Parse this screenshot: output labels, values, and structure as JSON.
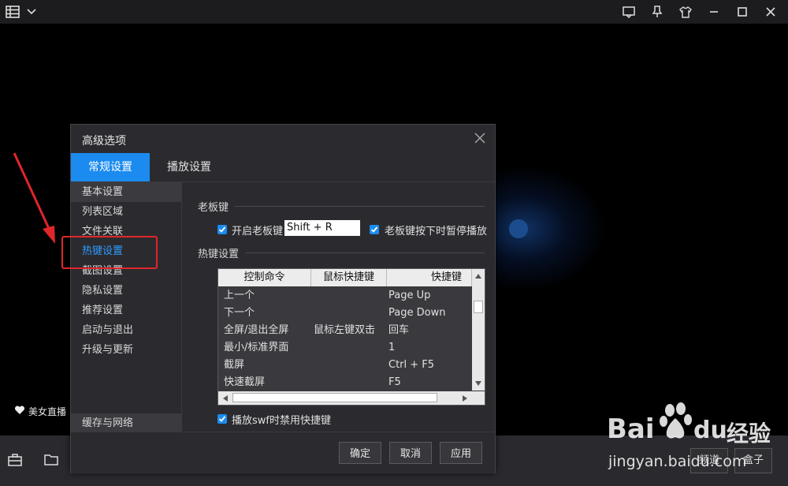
{
  "dialog": {
    "title": "高级选项",
    "tabs": [
      {
        "label": "常规设置",
        "active": true
      },
      {
        "label": "播放设置",
        "active": false
      }
    ],
    "sidebar": [
      {
        "label": "基本设置"
      },
      {
        "label": "列表区域"
      },
      {
        "label": "文件关联"
      },
      {
        "label": "热键设置",
        "selected": true
      },
      {
        "label": "截图设置"
      },
      {
        "label": "隐私设置"
      },
      {
        "label": "推荐设置"
      },
      {
        "label": "启动与退出"
      },
      {
        "label": "升级与更新"
      }
    ],
    "sidebar_bottom": "缓存与网络",
    "boss_key": {
      "section": "老板键",
      "enable_label": "开启老板键",
      "enable_checked": true,
      "hotkey_value": "Shift + R",
      "pause_label": "老板键按下时暂停播放",
      "pause_checked": true
    },
    "hotkeys": {
      "section": "热键设置",
      "columns": [
        "控制命令",
        "鼠标快捷键",
        "快捷键"
      ],
      "rows": [
        [
          "上一个",
          "",
          "Page Up"
        ],
        [
          "下一个",
          "",
          "Page Down"
        ],
        [
          "全屏/退出全屏",
          "鼠标左键双击",
          "回车"
        ],
        [
          "最小/标准界面",
          "",
          "1"
        ],
        [
          "截屏",
          "",
          "Ctrl + F5"
        ],
        [
          "快速截屏",
          "",
          "F5"
        ]
      ],
      "disable_swf_label": "播放swf时禁用快捷键",
      "disable_swf_checked": true
    },
    "buttons": {
      "ok": "确定",
      "cancel": "取消",
      "apply": "应用"
    }
  },
  "player": {
    "live_label": "美女直播",
    "bottom_buttons": [
      "频道",
      "盒子"
    ]
  },
  "watermark": {
    "brand": "Bai",
    "brand2": "du",
    "cn": "经验",
    "url": "jingyan.baidu.com"
  },
  "colors": {
    "accent": "#1b8bf0",
    "selected_text": "#2f9bff",
    "annotation": "#e0262a",
    "dialog_bg": "#2b2b2f"
  }
}
